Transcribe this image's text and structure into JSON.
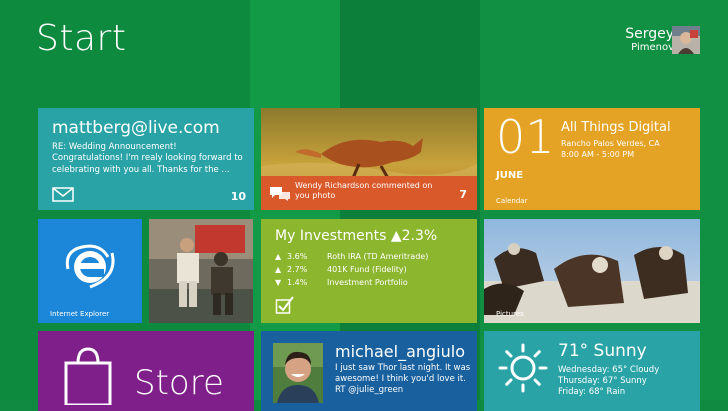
{
  "start": {
    "title": "Start"
  },
  "user": {
    "first_name": "Sergey",
    "last_name": "Pimenov"
  },
  "mail": {
    "address": "mattberg@live.com",
    "subject": "RE: Wedding Announcement!",
    "preview": "Congratulations! I'm realy looking forward to celebrating with you all. Thanks for the ...",
    "count": "10"
  },
  "photo_social": {
    "caption": "Wendy Richardson commented on you photo",
    "count": "7"
  },
  "calendar": {
    "day": "01",
    "month": "JUNE",
    "event_title": "All Things Digital",
    "event_location": "Rancho Palos Verdes, CA",
    "event_time": "8:00 AM - 5:00 PM",
    "label": "Calendar"
  },
  "ie": {
    "label": "Internet Explorer"
  },
  "investments": {
    "title": "My Investments ▲2.3%",
    "rows": [
      {
        "arrow": "▲",
        "pct": "3.6%",
        "name": "Roth IRA (TD Ameritrade)"
      },
      {
        "arrow": "▲",
        "pct": "2.7%",
        "name": "401K Fund (Fidelity)"
      },
      {
        "arrow": "▼",
        "pct": "1.4%",
        "name": "Investment Portfolio"
      }
    ]
  },
  "pictures": {
    "label": "Pictures"
  },
  "store": {
    "label": "Store"
  },
  "twitter": {
    "handle": "michael_angiulo",
    "message": "I just saw Thor last night. It was awesome! I think you'd love it. RT @julie_green"
  },
  "weather": {
    "current": "71° Sunny",
    "forecast": [
      "Wednesday: 65° Cloudy",
      "Thursday: 67° Sunny",
      "Friday: 68° Rain"
    ]
  },
  "colors": {
    "background": "#0f8a40",
    "mail_tile": "#2aa3a7",
    "photo_caption": "#d9592b",
    "calendar_tile": "#e4a325",
    "ie_tile": "#1c86d8",
    "investments_tile": "#8cb62e",
    "store_tile": "#7e1f8a",
    "twitter_tile": "#19609e",
    "weather_tile": "#2aa3a7"
  },
  "icons": {
    "mail": "envelope-icon",
    "comment": "speech-bubble-icon",
    "ie": "internet-explorer-logo",
    "investments": "checkbox-tick-icon",
    "store": "shopping-bag-icon",
    "weather": "sun-icon"
  }
}
